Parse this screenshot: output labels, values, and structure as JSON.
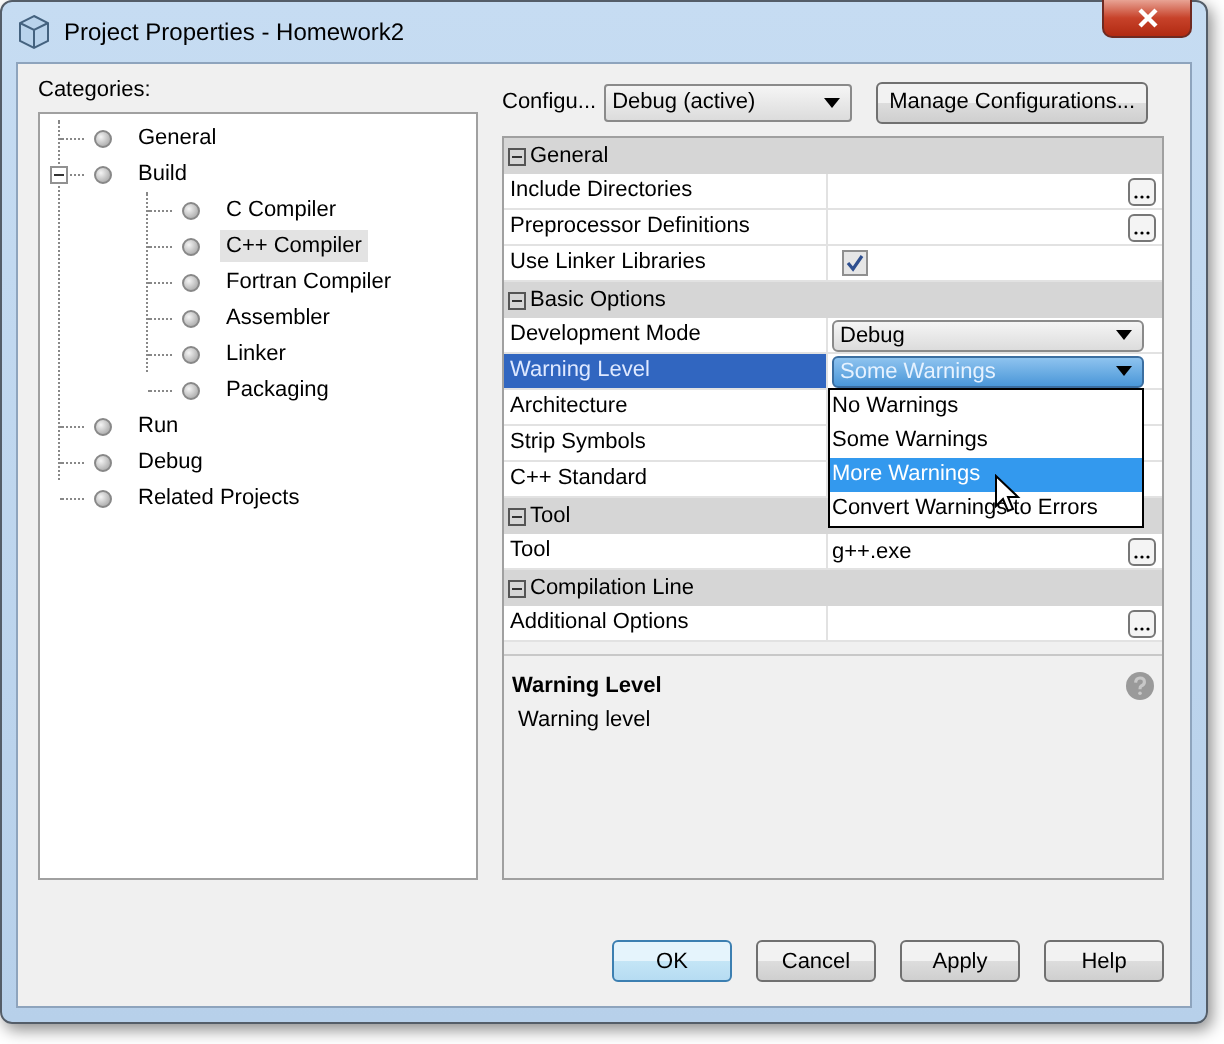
{
  "window": {
    "title": "Project Properties - Homework2"
  },
  "categories": {
    "label": "Categories:",
    "items": [
      {
        "label": "General",
        "selected": false
      },
      {
        "label": "Build",
        "selected": false,
        "expanded": true,
        "children": [
          {
            "label": "C Compiler",
            "selected": false
          },
          {
            "label": "C++ Compiler",
            "selected": true
          },
          {
            "label": "Fortran Compiler",
            "selected": false
          },
          {
            "label": "Assembler",
            "selected": false
          },
          {
            "label": "Linker",
            "selected": false
          },
          {
            "label": "Packaging",
            "selected": false
          }
        ]
      },
      {
        "label": "Run",
        "selected": false
      },
      {
        "label": "Debug",
        "selected": false
      },
      {
        "label": "Related Projects",
        "selected": false
      }
    ]
  },
  "configuration": {
    "label": "Configu...",
    "value": "Debug (active)",
    "manage_button": "Manage Configurations..."
  },
  "property_sheet": {
    "sections": [
      {
        "title": "General",
        "expanded": true,
        "rows": [
          {
            "label": "Include Directories",
            "kind": "ellipsis",
            "selected": false
          },
          {
            "label": "Preprocessor Definitions",
            "kind": "ellipsis",
            "selected": false
          },
          {
            "label": "Use Linker Libraries",
            "kind": "checkbox",
            "checked": true,
            "selected": false
          }
        ]
      },
      {
        "title": "Basic Options",
        "expanded": true,
        "rows": [
          {
            "label": "Development Mode",
            "kind": "combo",
            "value": "Debug",
            "selected": false
          },
          {
            "label": "Warning Level",
            "kind": "combo",
            "value": "Some Warnings",
            "selected": true,
            "open": true
          },
          {
            "label": "Architecture",
            "kind": "hidden",
            "selected": false
          },
          {
            "label": "Strip Symbols",
            "kind": "hidden",
            "selected": false
          },
          {
            "label": "C++ Standard",
            "kind": "hidden",
            "selected": false
          }
        ]
      },
      {
        "title": "Tool",
        "expanded": true,
        "rows": [
          {
            "label": "Tool",
            "kind": "ellipsis",
            "value": "g++.exe",
            "selected": false
          }
        ]
      },
      {
        "title": "Compilation Line",
        "expanded": true,
        "rows": [
          {
            "label": "Additional Options",
            "kind": "ellipsis",
            "selected": false
          }
        ]
      }
    ]
  },
  "dropdown": {
    "options": [
      {
        "label": "No Warnings",
        "selected": false
      },
      {
        "label": "Some Warnings",
        "selected": false
      },
      {
        "label": "More Warnings",
        "selected": true
      },
      {
        "label": "Convert Warnings to Errors",
        "selected": false
      }
    ]
  },
  "description": {
    "title": "Warning Level",
    "text": "Warning level"
  },
  "buttons": [
    {
      "label": "OK",
      "default": true
    },
    {
      "label": "Cancel",
      "default": false
    },
    {
      "label": "Apply",
      "default": false
    },
    {
      "label": "Help",
      "default": false
    }
  ]
}
